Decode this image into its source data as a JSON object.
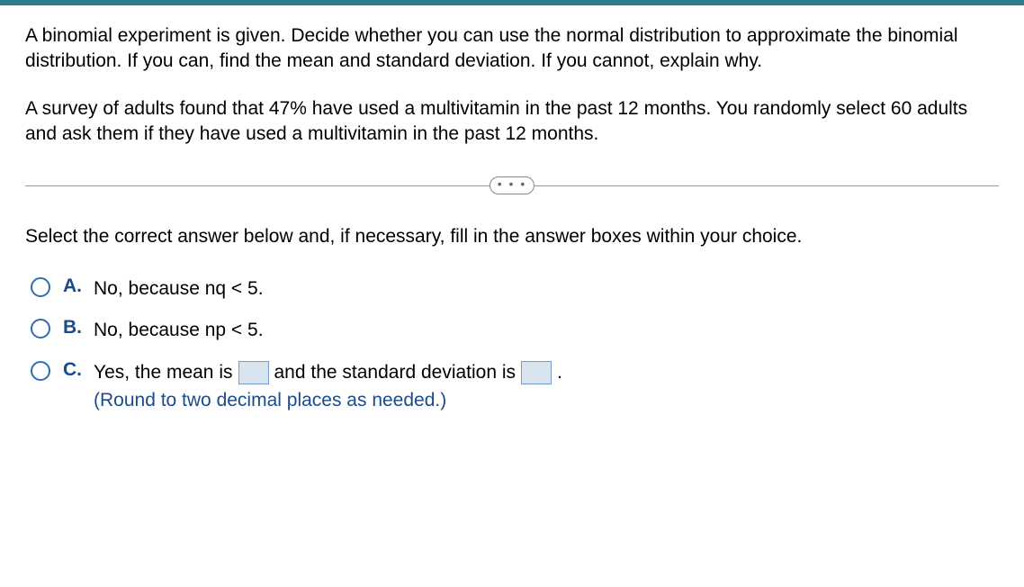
{
  "question": {
    "prompt": "A binomial experiment is given. Decide whether you can use the normal distribution to approximate the binomial distribution. If you can, find the mean and standard deviation. If you cannot, explain why.",
    "scenario": "A survey of adults found that 47% have used a multivitamin in the past 12 months. You randomly select 60 adults and ask them if they have used a multivitamin in the past 12 months."
  },
  "divider_dots": "• • •",
  "instruction": "Select the correct answer below and, if necessary, fill in the answer boxes within your choice.",
  "options": {
    "a": {
      "label": "A.",
      "text": "No, because nq < 5."
    },
    "b": {
      "label": "B.",
      "text": "No, because np < 5."
    },
    "c": {
      "label": "C.",
      "text_part1": "Yes, the mean is",
      "text_part2": "and the standard deviation is",
      "text_part3": ".",
      "hint": "(Round to two decimal places as needed.)"
    }
  }
}
